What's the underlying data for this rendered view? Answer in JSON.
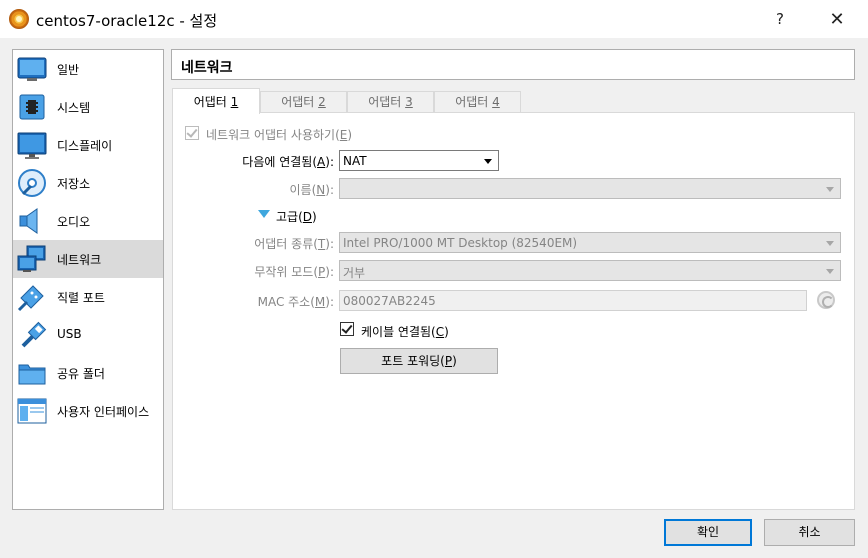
{
  "window": {
    "title": "centos7-oracle12c - 설정",
    "help_label": "?",
    "close_label": "✕"
  },
  "sidebar": {
    "items": [
      {
        "label": "일반",
        "icon": "general-icon"
      },
      {
        "label": "시스템",
        "icon": "system-icon"
      },
      {
        "label": "디스플레이",
        "icon": "display-icon"
      },
      {
        "label": "저장소",
        "icon": "storage-icon"
      },
      {
        "label": "오디오",
        "icon": "audio-icon"
      },
      {
        "label": "네트워크",
        "icon": "network-icon"
      },
      {
        "label": "직렬 포트",
        "icon": "serial-port-icon"
      },
      {
        "label": "USB",
        "icon": "usb-icon"
      },
      {
        "label": "공유 폴더",
        "icon": "shared-folder-icon"
      },
      {
        "label": "사용자 인터페이스",
        "icon": "user-interface-icon"
      }
    ],
    "selected": "네트워크"
  },
  "header": {
    "title": "네트워크"
  },
  "tabs": [
    {
      "label": "어댑터 ",
      "key": "1"
    },
    {
      "label": "어댑터 ",
      "key": "2"
    },
    {
      "label": "어댑터 ",
      "key": "3"
    },
    {
      "label": "어댑터 ",
      "key": "4"
    }
  ],
  "form": {
    "enable_adapter": {
      "label": "네트워크 어댑터 사용하기(",
      "key": "E",
      "suffix": ")",
      "checked": true
    },
    "attached_to": {
      "label": "다음에 연결됨(",
      "key": "A",
      "suffix": "):",
      "value": "NAT"
    },
    "name": {
      "label": "이름(",
      "key": "N",
      "suffix": "):",
      "value": ""
    },
    "advanced": {
      "label": "고급(",
      "key": "D",
      "suffix": ")"
    },
    "adapter_type": {
      "label": "어댑터 종류(",
      "key": "T",
      "suffix": "):",
      "value": "Intel PRO/1000 MT Desktop (82540EM)"
    },
    "promiscuous": {
      "label": "무작위 모드(",
      "key": "P",
      "suffix": "):",
      "value": "거부"
    },
    "mac": {
      "label": "MAC 주소(",
      "key": "M",
      "suffix": "):",
      "value": "080027AB2245"
    },
    "cable": {
      "label": "케이블 연결됨(",
      "key": "C",
      "suffix": ")",
      "checked": true
    },
    "port_forwarding": {
      "label": "포트 포워딩(",
      "key": "P",
      "suffix": ")"
    }
  },
  "footer": {
    "ok_label": "확인",
    "cancel_label": "취소"
  },
  "colors": {
    "accent": "#0078d7",
    "selected_bg": "#dadada",
    "window_bg": "#f0f0f0"
  }
}
